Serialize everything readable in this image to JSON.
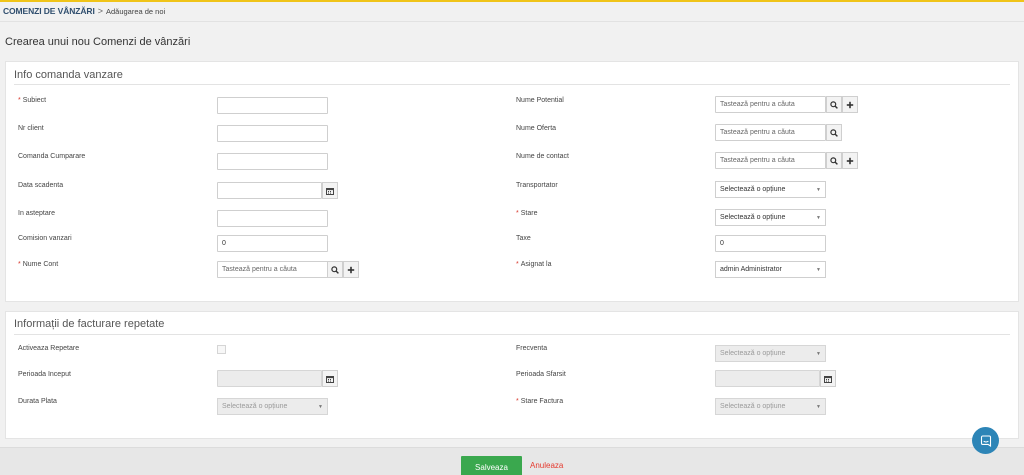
{
  "breadcrumb": {
    "module": "COMENZI DE VÂNZĂRI",
    "separator": ">",
    "page": "Adăugarea de noi"
  },
  "page_title": "Crearea unui nou Comenzi de vânzări",
  "section1": {
    "title": "Info comanda vanzare",
    "fields": {
      "subiect": {
        "label": "Subiect",
        "value": ""
      },
      "nr_client": {
        "label": "Nr client",
        "value": ""
      },
      "comanda_cumparare": {
        "label": "Comanda Cumparare",
        "value": ""
      },
      "data_scadenta": {
        "label": "Data scadenta",
        "value": ""
      },
      "in_asteptare": {
        "label": "In asteptare",
        "value": ""
      },
      "comision_vanzari": {
        "label": "Comision vanzari",
        "value": "0"
      },
      "nume_cont": {
        "label": "Nume Cont",
        "placeholder": "Tastează pentru a căuta"
      },
      "nume_potential": {
        "label": "Nume Potential",
        "placeholder": "Tastează pentru a căuta"
      },
      "nume_oferta": {
        "label": "Nume Oferta",
        "placeholder": "Tastează pentru a căuta"
      },
      "nume_de_contact": {
        "label": "Nume de contact",
        "placeholder": "Tastează pentru a căuta"
      },
      "transportator": {
        "label": "Transportator",
        "value": "Selectează o opțiune"
      },
      "stare": {
        "label": "Stare",
        "value": "Selectează o opțiune"
      },
      "taxe": {
        "label": "Taxe",
        "value": "0"
      },
      "asignat_la": {
        "label": "Asignat la",
        "value": "admin Administrator"
      }
    }
  },
  "section2": {
    "title": "Informații de facturare repetate",
    "fields": {
      "activeaza_repetare": {
        "label": "Activeaza Repetare",
        "checked": false
      },
      "perioada_inceput": {
        "label": "Perioada Inceput",
        "value": ""
      },
      "durata_plata": {
        "label": "Durata Plata",
        "value": "Selectează o opțiune"
      },
      "frecventa": {
        "label": "Frecventa",
        "value": "Selectează o opțiune"
      },
      "perioada_sfarsit": {
        "label": "Perioada Sfarsit",
        "value": ""
      },
      "stare_factura": {
        "label": "Stare Factura",
        "value": "Selectează o opțiune"
      }
    }
  },
  "required_marker": "*",
  "footer": {
    "save_label": "Salveaza",
    "cancel_label": "Anuleaza"
  },
  "icons": {
    "search": "search-icon",
    "add": "plus-icon",
    "calendar": "calendar-icon",
    "caret": "caret-down-icon",
    "chat": "chat-icon"
  },
  "colors": {
    "accent_top": "#f0c419",
    "save": "#3aa84e",
    "cancel": "#e53a2f",
    "required": "#d9372c",
    "chat": "#2d85b7",
    "breadcrumb": "#2f4e6e"
  }
}
